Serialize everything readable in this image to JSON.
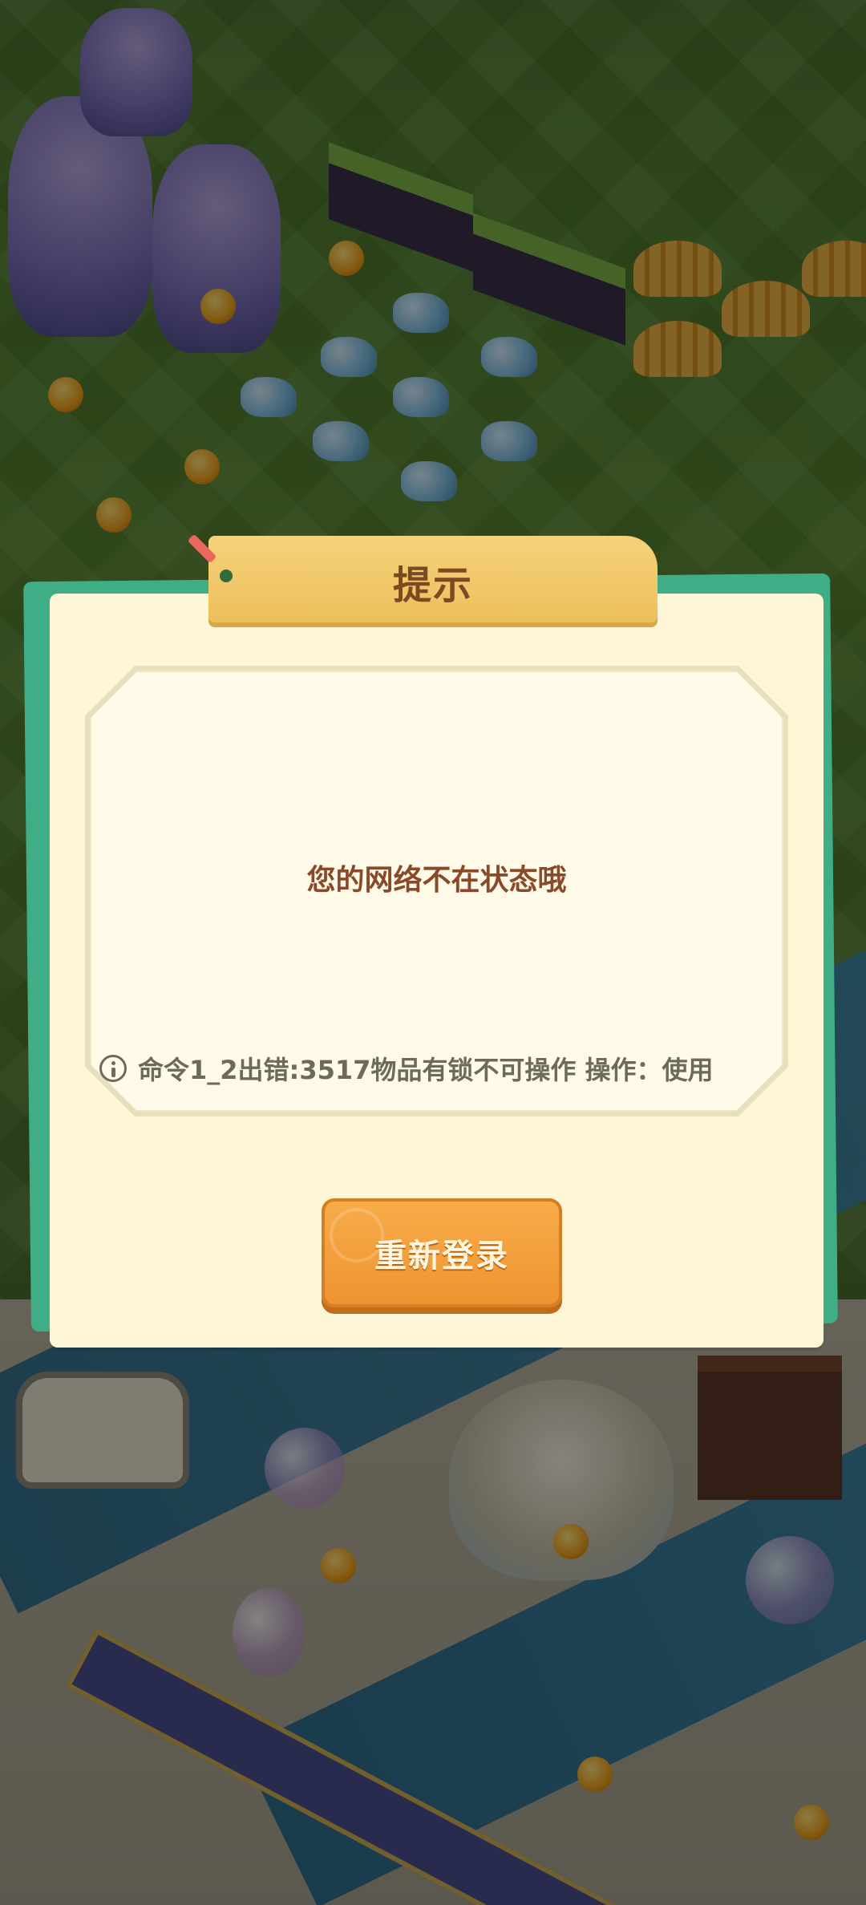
{
  "dialog": {
    "title": "提示",
    "message": "您的网络不在状态哦",
    "error_text": "命令1_2出错:3517物品有锁不可操作  操作：使用",
    "info_icon": "info-icon",
    "button_label": "重新登录"
  },
  "colors": {
    "dialog_background": "#fdf7d8",
    "dialog_border": "#3fae86",
    "title_ribbon": "#f3cd72",
    "title_text": "#7a4a22",
    "message_text": "#8a4a2a",
    "error_text": "#6d6a5c",
    "button": "#f2a03c",
    "button_text": "#fff6e0"
  }
}
